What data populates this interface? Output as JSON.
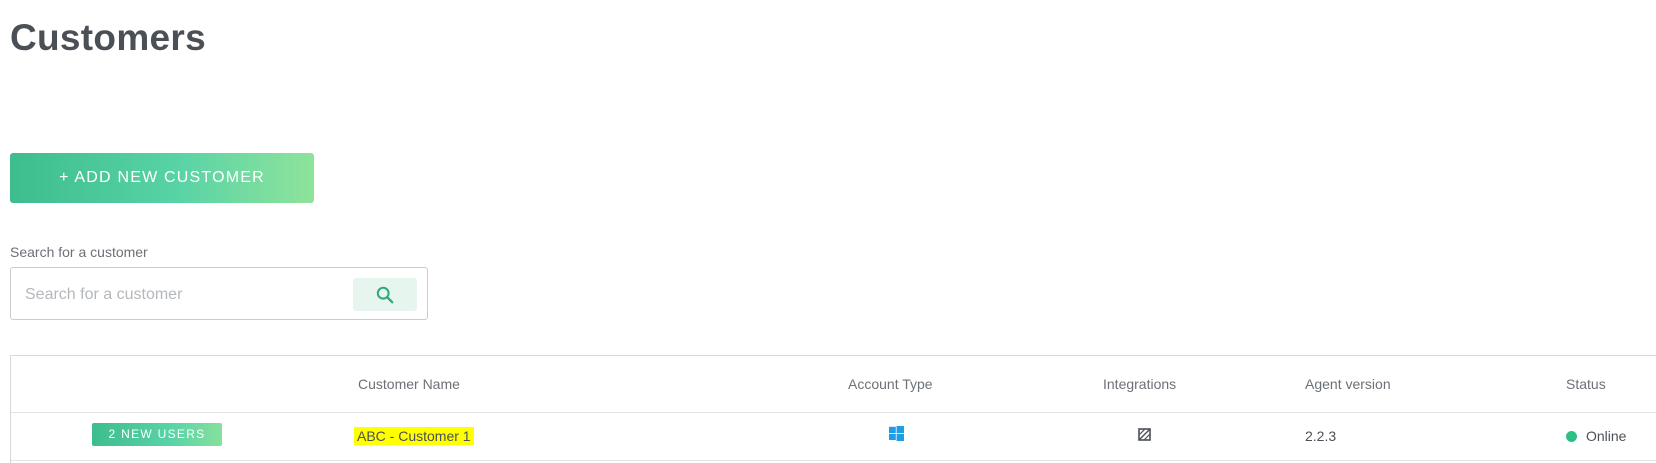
{
  "page": {
    "title": "Customers"
  },
  "actions": {
    "add_customer_label": "+ ADD NEW CUSTOMER"
  },
  "search": {
    "label": "Search for a customer",
    "placeholder": "Search for a customer",
    "value": "",
    "button_icon": "search-icon"
  },
  "table": {
    "columns": [
      "",
      "Customer Name",
      "Account Type",
      "Integrations",
      "Agent version",
      "Status"
    ],
    "rows": [
      {
        "badge": "2 NEW USERS",
        "customer_name": "ABC - Customer 1",
        "account_type_icon": "windows-icon",
        "integrations_icon": "no-integration-icon",
        "agent_version": "2.2.3",
        "status": "Online"
      }
    ]
  },
  "colors": {
    "accent": "#3dbd8e",
    "accent_light": "#8fe39b",
    "highlight": "#ffff00",
    "status_online": "#2fbf86",
    "windows_blue": "#1e9ee8"
  }
}
